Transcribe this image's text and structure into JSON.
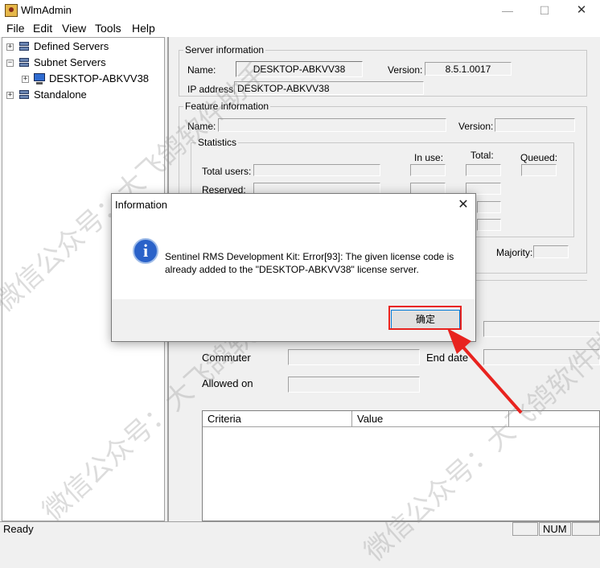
{
  "window": {
    "title": "WlmAdmin",
    "minimize": "—",
    "maximize": "☐",
    "close": "✕"
  },
  "menu": [
    "File",
    "Edit",
    "View",
    "Tools",
    "Help"
  ],
  "tree": {
    "items": [
      {
        "label": "Defined Servers",
        "expander": "+"
      },
      {
        "label": "Subnet Servers",
        "expander": "−"
      },
      {
        "label": "DESKTOP-ABKVV38",
        "expander": "+"
      },
      {
        "label": "Standalone",
        "expander": "+"
      }
    ]
  },
  "server_info": {
    "group_label": "Server information",
    "name_label": "Name:",
    "name_value": "DESKTOP-ABKVV38",
    "version_label": "Version:",
    "version_value": "8.5.1.0017",
    "ip_label": "IP address:",
    "ip_value": "DESKTOP-ABKVV38"
  },
  "feature_info": {
    "group_label": "Feature information",
    "name_label": "Name:",
    "version_label": "Version:",
    "statistics_label": "Statistics",
    "in_use_label": "In use:",
    "total_label": "Total:",
    "queued_label": "Queued:",
    "total_users_label": "Total users:",
    "reserved_label": "Reserved:",
    "majority_label": "Majority:"
  },
  "lower": {
    "commuter_label": "Commuter",
    "end_date_label": "End date",
    "allowed_on_label": "Allowed on"
  },
  "table": {
    "columns": [
      "Criteria",
      "Value"
    ]
  },
  "statusbar": {
    "text": "Ready",
    "num": "NUM"
  },
  "dialog": {
    "title": "Information",
    "close": "✕",
    "icon_glyph": "i",
    "message_line1": "Sentinel RMS Development Kit: Error[93]: The given license code is",
    "message_line2": "already added to the \"DESKTOP-ABKVV38\" license server.",
    "ok_label": "确定"
  },
  "watermark": {
    "text_1": "微信公众号：大飞鸽软件助手",
    "text_2": "微信公众号：大飞鸽软件助手",
    "text_3": "微信公众号：大飞鸽软件助手"
  },
  "colors": {
    "highlight": "#e8231f",
    "dialog_icon": "#2a62c9",
    "button_focus": "#0078d7"
  },
  "icons": [
    "app-icon",
    "server-icon",
    "computer-icon",
    "info-icon",
    "close-icon",
    "arrow-annotation"
  ]
}
